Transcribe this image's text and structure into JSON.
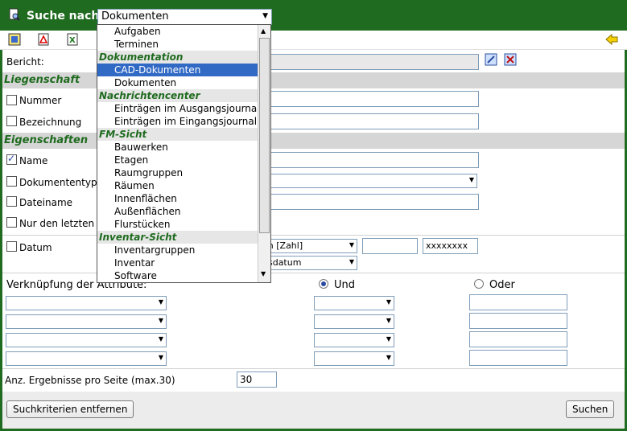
{
  "title": "Suche nach",
  "type_select": {
    "value": "Dokumenten"
  },
  "fields": {
    "bericht": "Bericht:",
    "liegenschaft": "Liegenschaft",
    "nummer": "Nummer",
    "bezeichnung": "Bezeichnung",
    "eigenschaften": "Eigenschaften",
    "name": "Name",
    "dokumententyp": "Dokumententyp",
    "dateiname": "Dateiname",
    "nur_letzten": "Nur den letzten I",
    "datum": "Datum",
    "datum_select1": "en [Zahl]",
    "datum_select2": "gsdatum",
    "datum_field2": "xxxxxxxx"
  },
  "verknuepfung": {
    "label": "Verknüpfung der Attribute:",
    "und": "Und",
    "oder": "Oder"
  },
  "anz": {
    "label": "Anz. Ergebnisse pro Seite (max.30)",
    "value": "30"
  },
  "buttons": {
    "remove": "Suchkriterien entfernen",
    "search": "Suchen"
  },
  "dropdown": [
    {
      "type": "item",
      "label": "Aufgaben"
    },
    {
      "type": "item",
      "label": "Terminen"
    },
    {
      "type": "group",
      "label": "Dokumentation"
    },
    {
      "type": "item",
      "label": "CAD-Dokumenten",
      "selected": true
    },
    {
      "type": "item",
      "label": "Dokumenten"
    },
    {
      "type": "group",
      "label": "Nachrichtencenter"
    },
    {
      "type": "item",
      "label": "Einträgen im Ausgangsjournal"
    },
    {
      "type": "item",
      "label": "Einträgen im Eingangsjournal"
    },
    {
      "type": "group",
      "label": "FM-Sicht"
    },
    {
      "type": "item",
      "label": "Bauwerken"
    },
    {
      "type": "item",
      "label": "Etagen"
    },
    {
      "type": "item",
      "label": "Raumgruppen"
    },
    {
      "type": "item",
      "label": "Räumen"
    },
    {
      "type": "item",
      "label": "Innenflächen"
    },
    {
      "type": "item",
      "label": "Außenflächen"
    },
    {
      "type": "item",
      "label": "Flurstücken"
    },
    {
      "type": "group",
      "label": "Inventar-Sicht"
    },
    {
      "type": "item",
      "label": "Inventargruppen"
    },
    {
      "type": "item",
      "label": "Inventar"
    },
    {
      "type": "item",
      "label": "Software"
    }
  ]
}
